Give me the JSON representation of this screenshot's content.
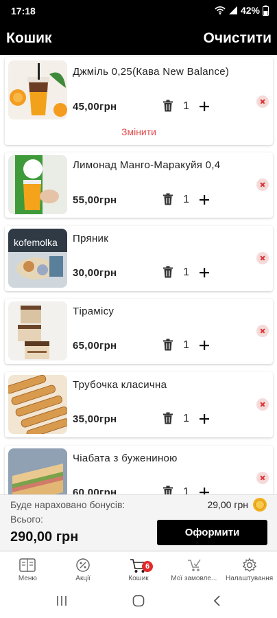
{
  "status": {
    "time": "17:18",
    "battery": "42%"
  },
  "header": {
    "title": "Кошик",
    "clear_label": "Очистити"
  },
  "cart": {
    "change_label": "Змінити",
    "items": [
      {
        "name": "Джміль 0,25(Кава New Balance)",
        "price": "45,00грн",
        "qty": "1"
      },
      {
        "name": "Лимонад Манго-Маракуйя 0,4",
        "price": "55,00грн",
        "qty": "1"
      },
      {
        "name": "Пряник",
        "price": "30,00грн",
        "qty": "1",
        "image_text": "kofemolka"
      },
      {
        "name": "Тірамісу",
        "price": "65,00грн",
        "qty": "1"
      },
      {
        "name": "Трубочка класична",
        "price": "35,00грн",
        "qty": "1"
      },
      {
        "name": "Чіабата з бужениною",
        "price": "60,00грн",
        "qty": "1"
      }
    ]
  },
  "summary": {
    "bonus_label": "Буде нараховано бонусів:",
    "bonus_value": "29,00 грн",
    "total_label": "Всього:",
    "total_value": "290,00 грн",
    "checkout_label": "Оформити"
  },
  "tabs": [
    {
      "label": "Меню",
      "icon": "menu-book-icon"
    },
    {
      "label": "Акції",
      "icon": "percent-badge-icon"
    },
    {
      "label": "Кошик",
      "icon": "cart-icon"
    },
    {
      "label": "Мої замовле...",
      "icon": "orders-icon"
    },
    {
      "label": "Налаштування",
      "icon": "gear-icon"
    }
  ],
  "cart_badge": "6",
  "colors": {
    "accent": "#000000",
    "link": "#e04a4a",
    "badge": "#e02a2a",
    "remove_bg": "#f5dada"
  }
}
